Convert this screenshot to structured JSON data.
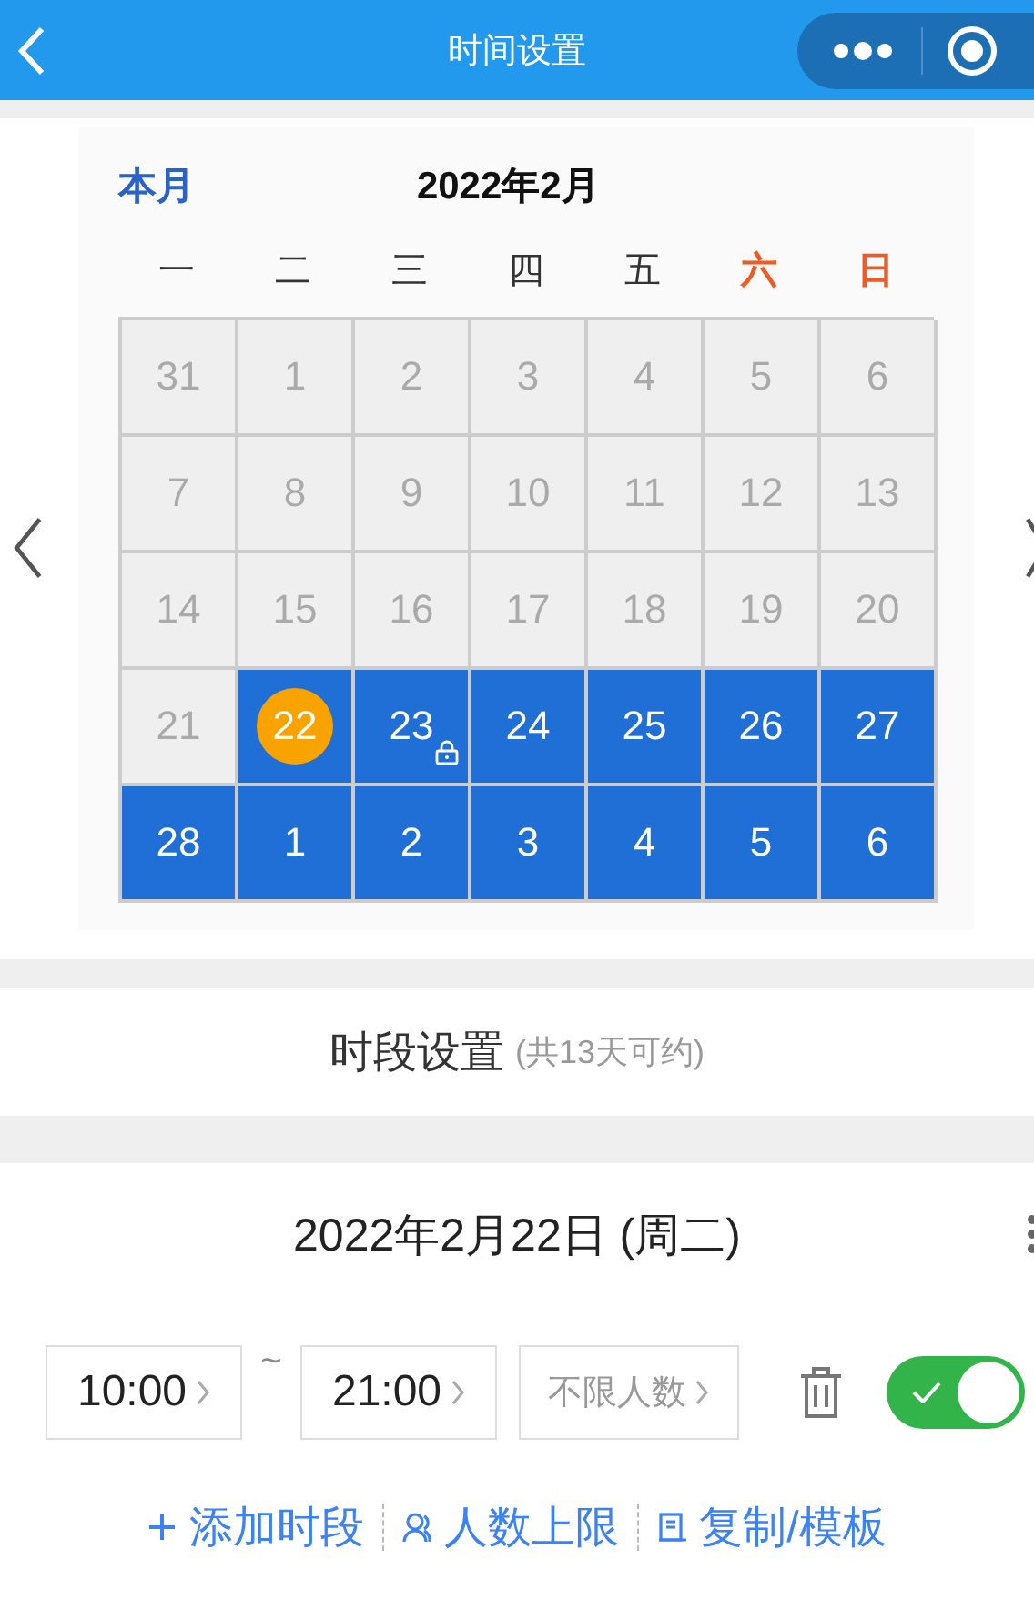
{
  "window": {
    "title": "时间设置"
  },
  "calendar": {
    "current_month_link": "本月",
    "month_title": "2022年2月",
    "weekdays": [
      {
        "label": "一",
        "weekend": false
      },
      {
        "label": "二",
        "weekend": false
      },
      {
        "label": "三",
        "weekend": false
      },
      {
        "label": "四",
        "weekend": false
      },
      {
        "label": "五",
        "weekend": false
      },
      {
        "label": "六",
        "weekend": true
      },
      {
        "label": "日",
        "weekend": true
      }
    ],
    "days": [
      {
        "label": "31",
        "kind": "past",
        "locked": false
      },
      {
        "label": "1",
        "kind": "past",
        "locked": false
      },
      {
        "label": "2",
        "kind": "past",
        "locked": false
      },
      {
        "label": "3",
        "kind": "past",
        "locked": false
      },
      {
        "label": "4",
        "kind": "past",
        "locked": false
      },
      {
        "label": "5",
        "kind": "past",
        "locked": false
      },
      {
        "label": "6",
        "kind": "past",
        "locked": false
      },
      {
        "label": "7",
        "kind": "past",
        "locked": false
      },
      {
        "label": "8",
        "kind": "past",
        "locked": false
      },
      {
        "label": "9",
        "kind": "past",
        "locked": false
      },
      {
        "label": "10",
        "kind": "past",
        "locked": false
      },
      {
        "label": "11",
        "kind": "past",
        "locked": false
      },
      {
        "label": "12",
        "kind": "past",
        "locked": false
      },
      {
        "label": "13",
        "kind": "past",
        "locked": false
      },
      {
        "label": "14",
        "kind": "past",
        "locked": false
      },
      {
        "label": "15",
        "kind": "past",
        "locked": false
      },
      {
        "label": "16",
        "kind": "past",
        "locked": false
      },
      {
        "label": "17",
        "kind": "past",
        "locked": false
      },
      {
        "label": "18",
        "kind": "past",
        "locked": false
      },
      {
        "label": "19",
        "kind": "past",
        "locked": false
      },
      {
        "label": "20",
        "kind": "past",
        "locked": false
      },
      {
        "label": "21",
        "kind": "past",
        "locked": false
      },
      {
        "label": "22",
        "kind": "selected",
        "locked": false
      },
      {
        "label": "23",
        "kind": "available",
        "locked": true
      },
      {
        "label": "24",
        "kind": "available",
        "locked": false
      },
      {
        "label": "25",
        "kind": "available",
        "locked": false
      },
      {
        "label": "26",
        "kind": "available",
        "locked": false
      },
      {
        "label": "27",
        "kind": "available",
        "locked": false
      },
      {
        "label": "28",
        "kind": "available",
        "locked": false
      },
      {
        "label": "1",
        "kind": "available",
        "locked": false
      },
      {
        "label": "2",
        "kind": "available",
        "locked": false
      },
      {
        "label": "3",
        "kind": "available",
        "locked": false
      },
      {
        "label": "4",
        "kind": "available",
        "locked": false
      },
      {
        "label": "5",
        "kind": "available",
        "locked": false
      },
      {
        "label": "6",
        "kind": "available",
        "locked": false
      }
    ]
  },
  "section": {
    "title": "时段设置",
    "note": "(共13天可约)"
  },
  "day_settings": {
    "date": "2022年2月22日 (周二)",
    "slot": {
      "start": "10:00",
      "separator": "~",
      "end": "21:00",
      "capacity_placeholder": "不限人数",
      "on": true
    },
    "links": [
      {
        "kind": "add",
        "label": "添加时段"
      },
      {
        "kind": "people",
        "label": "人数上限"
      },
      {
        "kind": "copy",
        "label": "复制/模板"
      }
    ]
  }
}
